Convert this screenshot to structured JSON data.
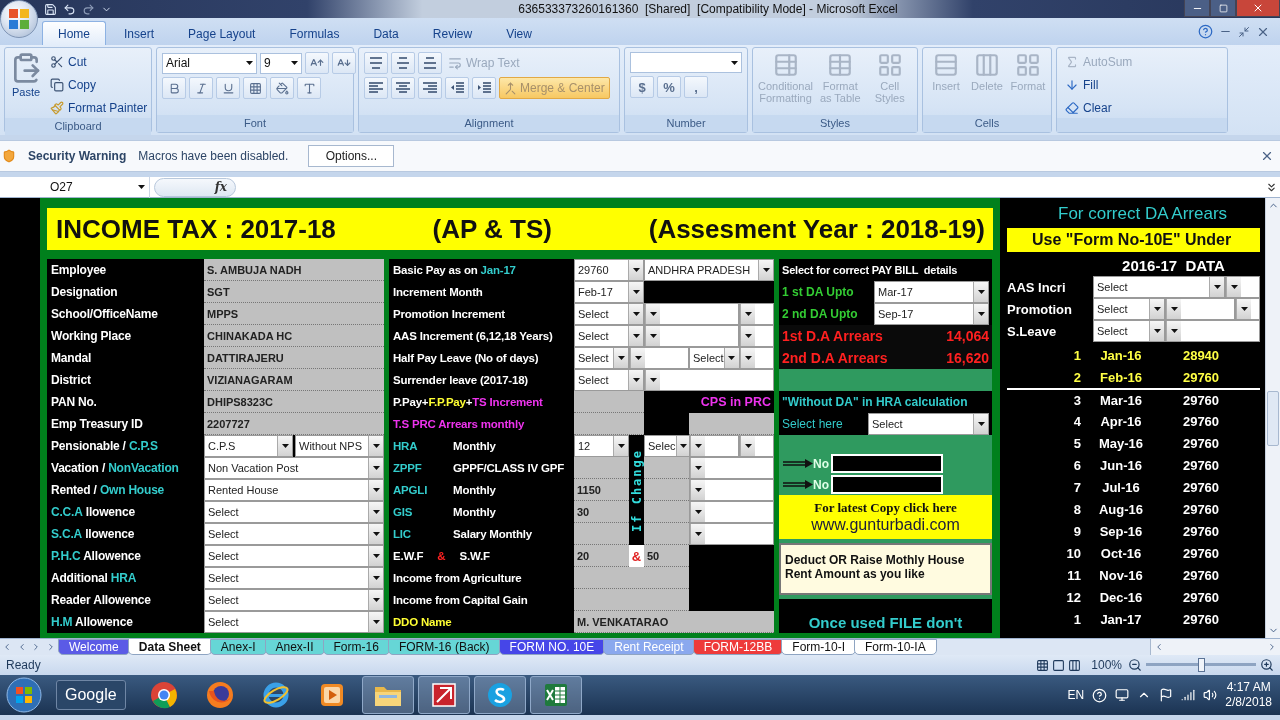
{
  "window": {
    "title": "636533373260161360  [Shared]  [Compatibility Mode] - Microsoft Excel"
  },
  "ribbon_tabs": [
    {
      "label": "Home",
      "selected": true
    },
    {
      "label": "Insert",
      "selected": false
    },
    {
      "label": "Page Layout",
      "selected": false
    },
    {
      "label": "Formulas",
      "selected": false
    },
    {
      "label": "Data",
      "selected": false
    },
    {
      "label": "Review",
      "selected": false
    },
    {
      "label": "View",
      "selected": false
    }
  ],
  "clipboard": {
    "label": "Clipboard",
    "paste": "Paste",
    "cut": "Cut",
    "copy": "Copy",
    "format_painter": "Format Painter"
  },
  "font": {
    "label": "Font",
    "name": "Arial",
    "size": "9"
  },
  "alignment": {
    "label": "Alignment",
    "wrap_text": "Wrap Text",
    "merge_center": "Merge & Center"
  },
  "number": {
    "label": "Number",
    "buttons": [
      "$",
      "%",
      ","
    ]
  },
  "styles": {
    "label": "Styles",
    "buttons": [
      {
        "label": "Conditional Formatting",
        "disabled": true
      },
      {
        "label": "Format as Table",
        "disabled": true
      },
      {
        "label": "Cell Styles",
        "disabled": true
      }
    ]
  },
  "cells": {
    "label": "Cells",
    "buttons": [
      {
        "label": "Insert",
        "disabled": true
      },
      {
        "label": "Delete",
        "disabled": true
      },
      {
        "label": "Format",
        "disabled": true
      }
    ]
  },
  "editing": {
    "buttons": [
      {
        "label": "AutoSum",
        "disabled": true
      },
      {
        "label": "Fill",
        "disabled": false
      },
      {
        "label": "Clear",
        "disabled": false
      }
    ]
  },
  "security_bar": {
    "title": "Security Warning",
    "message": "Macros have been disabled.",
    "button": "Options..."
  },
  "formula_bar": {
    "name_box": "O27",
    "function_label": "fx"
  },
  "banner": {
    "title": "INCOME TAX : 2017-18",
    "region": "(AP & TS)",
    "year": "(Assesment Year : 2018-19)"
  },
  "employee_rows": [
    {
      "label": [
        {
          "text": "Employee",
          "color": "#ffffff"
        }
      ],
      "fields": [
        {
          "kind": "text",
          "value": "S. AMBUJA NADH"
        }
      ]
    },
    {
      "label": [
        {
          "text": "Designation",
          "color": "#ffffff"
        }
      ],
      "fields": [
        {
          "kind": "text",
          "value": "SGT"
        }
      ]
    },
    {
      "label": [
        {
          "text": "School/OfficeName",
          "color": "#ffffff"
        }
      ],
      "fields": [
        {
          "kind": "text",
          "value": "MPPS"
        }
      ]
    },
    {
      "label": [
        {
          "text": "Working Place",
          "color": "#ffffff"
        }
      ],
      "fields": [
        {
          "kind": "text",
          "value": "CHINAKADA HC"
        }
      ]
    },
    {
      "label": [
        {
          "text": "Mandal",
          "color": "#ffffff"
        }
      ],
      "fields": [
        {
          "kind": "text",
          "value": "DATTIRAJERU"
        }
      ]
    },
    {
      "label": [
        {
          "text": "District",
          "color": "#ffffff"
        }
      ],
      "fields": [
        {
          "kind": "text",
          "value": "VIZIANAGARAM"
        }
      ]
    },
    {
      "label": [
        {
          "text": "PAN No.",
          "color": "#ffffff"
        }
      ],
      "fields": [
        {
          "kind": "text",
          "value": "DHIPS8323C"
        }
      ]
    },
    {
      "label": [
        {
          "text": "Emp Treasury ID",
          "color": "#ffffff"
        }
      ],
      "fields": [
        {
          "kind": "text",
          "value": "2207727"
        }
      ]
    },
    {
      "label": [
        {
          "text": "Pensionable / ",
          "color": "#ffffff"
        },
        {
          "text": "C.P.S",
          "color": "#33cccc"
        }
      ],
      "fields": [
        {
          "kind": "select",
          "value": "C.P.S"
        },
        {
          "kind": "select",
          "value": "Without NPS"
        }
      ]
    },
    {
      "label": [
        {
          "text": "Vacation / ",
          "color": "#ffffff"
        },
        {
          "text": "NonVacation",
          "color": "#33cccc"
        }
      ],
      "fields": [
        {
          "kind": "select",
          "value": "Non Vacation Post"
        }
      ]
    },
    {
      "label": [
        {
          "text": "Rented / ",
          "color": "#ffffff"
        },
        {
          "text": "Own House",
          "color": "#33cccc"
        }
      ],
      "fields": [
        {
          "kind": "select",
          "value": "Rented House"
        }
      ]
    },
    {
      "label": [
        {
          "text": "C.C.A",
          "color": "#33cccc"
        },
        {
          "text": " llowence",
          "color": "#ffffff"
        }
      ],
      "fields": [
        {
          "kind": "select",
          "value": "Select"
        }
      ]
    },
    {
      "label": [
        {
          "text": "S.C.A",
          "color": "#33cccc"
        },
        {
          "text": " llowence",
          "color": "#ffffff"
        }
      ],
      "fields": [
        {
          "kind": "select",
          "value": "Select"
        }
      ]
    },
    {
      "label": [
        {
          "text": "P.H.C",
          "color": "#33cccc"
        },
        {
          "text": " Allowence",
          "color": "#ffffff"
        }
      ],
      "fields": [
        {
          "kind": "select",
          "value": "Select"
        }
      ]
    },
    {
      "label": [
        {
          "text": "Additional ",
          "color": "#ffffff"
        },
        {
          "text": "HRA",
          "color": "#33cccc"
        }
      ],
      "fields": [
        {
          "kind": "select",
          "value": "Select"
        }
      ]
    },
    {
      "label": [
        {
          "text": "Reader Allowence",
          "color": "#ffffff"
        }
      ],
      "fields": [
        {
          "kind": "select",
          "value": "Select"
        }
      ]
    },
    {
      "label": [
        {
          "text": "H.M",
          "color": "#33cccc"
        },
        {
          "text": " Allowence",
          "color": "#ffffff"
        }
      ],
      "fields": [
        {
          "kind": "select",
          "value": "Select"
        }
      ]
    }
  ],
  "pay_rows": [
    {
      "kind": "two",
      "label": [
        {
          "text": "Basic Pay as on ",
          "color": "#ffffff"
        },
        {
          "text": "Jan-17",
          "color": "#33cccc"
        }
      ],
      "fields": [
        {
          "kind": "select",
          "value": "29760"
        },
        {
          "kind": "select",
          "value": "ANDHRA PRADESH"
        }
      ]
    },
    {
      "kind": "two",
      "label": [
        {
          "text": "Increment Month",
          "color": "#ffffff"
        }
      ],
      "fields": [
        {
          "kind": "select",
          "value": "Feb-17"
        },
        {
          "kind": "black"
        }
      ]
    },
    {
      "kind": "triple",
      "label": [
        {
          "text": "Promotion Increment",
          "color": "#ffffff"
        }
      ],
      "fields": [
        {
          "kind": "select",
          "value": "Select"
        },
        {
          "kind": "select"
        },
        {
          "kind": "select"
        }
      ]
    },
    {
      "kind": "triple",
      "label": [
        {
          "text": "AAS Increment (6,12,18 Years)",
          "color": "#ffffff"
        }
      ],
      "fields": [
        {
          "kind": "select",
          "value": "Select"
        },
        {
          "kind": "select"
        },
        {
          "kind": "select"
        }
      ]
    },
    {
      "kind": "quad",
      "label": [
        {
          "text": "Half Pay Leave (No of days)",
          "color": "#ffffff"
        }
      ],
      "fields": [
        {
          "kind": "select",
          "value": "Select"
        },
        {
          "kind": "select"
        },
        {
          "kind": "select",
          "value": "Select"
        },
        {
          "kind": "select"
        }
      ]
    },
    {
      "kind": "two",
      "label": [
        {
          "text": "Surrender leave (2017-18)",
          "color": "#ffffff"
        }
      ],
      "fields": [
        {
          "kind": "select",
          "value": "Select"
        },
        {
          "kind": "select"
        }
      ]
    },
    {
      "kind": "two",
      "label": [
        {
          "text": "P.Pay+",
          "color": "#ffffff"
        },
        {
          "text": "F.P.Pay",
          "color": "#ffff33"
        },
        {
          "text": "+",
          "color": "#ffffff"
        },
        {
          "text": "TS Increment",
          "color": "#ee33ee"
        }
      ],
      "fields": [
        {
          "kind": "text"
        },
        {
          "kind": "note",
          "value": "CPS in PRC"
        }
      ]
    },
    {
      "kind": "band",
      "label": [
        {
          "text": "T.S PRC Arrears monthly",
          "color": "#ee33ee"
        }
      ],
      "fields": [
        {
          "kind": "text"
        },
        {
          "kind": "black"
        },
        {
          "kind": "text"
        }
      ]
    },
    {
      "kind": "hra",
      "label": [
        {
          "text": "HRA",
          "color": "#33cccc"
        },
        {
          "text": "Monthly",
          "color": "#ffffff"
        }
      ],
      "fields": [
        {
          "kind": "select",
          "value": "12"
        },
        {
          "kind": "vertical",
          "value": "If Change"
        },
        {
          "kind": "select",
          "value": "Selec"
        },
        {
          "kind": "select"
        },
        {
          "kind": "select"
        }
      ]
    },
    {
      "kind": "ded",
      "label": [
        {
          "text": "ZPPF",
          "color": "#33cccc"
        },
        {
          "text": "GPPF/CLASS IV GPF",
          "color": "#ffffff"
        }
      ],
      "fields": [
        {
          "kind": "text"
        },
        {
          "kind": "text"
        },
        {
          "kind": "select"
        }
      ]
    },
    {
      "kind": "ded",
      "label": [
        {
          "text": "APGLI",
          "color": "#33cccc"
        },
        {
          "text": "Monthly",
          "color": "#ffffff"
        }
      ],
      "fields": [
        {
          "kind": "text",
          "value": "1150"
        },
        {
          "kind": "text"
        },
        {
          "kind": "select"
        }
      ]
    },
    {
      "kind": "ded",
      "label": [
        {
          "text": "GIS",
          "color": "#33cccc"
        },
        {
          "text": "Monthly",
          "color": "#ffffff"
        }
      ],
      "fields": [
        {
          "kind": "text",
          "value": "30"
        },
        {
          "kind": "text"
        },
        {
          "kind": "select"
        }
      ]
    },
    {
      "kind": "ded",
      "label": [
        {
          "text": "LIC",
          "color": "#33cccc"
        },
        {
          "text": "Salary Monthly",
          "color": "#ffffff"
        }
      ],
      "fields": [
        {
          "kind": "text"
        },
        {
          "kind": "text"
        },
        {
          "kind": "select"
        }
      ]
    },
    {
      "kind": "amp",
      "label": [
        {
          "text": "E.W.F",
          "color": "#ffffff"
        },
        {
          "text": "&",
          "color": "#ff2222"
        },
        {
          "text": "S.W.F",
          "color": "#ffffff"
        }
      ],
      "fields": [
        {
          "kind": "text",
          "value": "20"
        },
        {
          "kind": "amp",
          "value": "&"
        },
        {
          "kind": "text",
          "value": "50"
        },
        {
          "kind": "black"
        }
      ]
    },
    {
      "kind": "plain",
      "label": [
        {
          "text": "Income from Agriculture",
          "color": "#ffffff"
        }
      ],
      "fields": [
        {
          "kind": "text"
        },
        {
          "kind": "black"
        }
      ]
    },
    {
      "kind": "plain",
      "label": [
        {
          "text": "Income from Capital Gain",
          "color": "#ffffff"
        }
      ],
      "fields": [
        {
          "kind": "text"
        },
        {
          "kind": "black"
        }
      ]
    },
    {
      "kind": "full",
      "label": [
        {
          "text": "DDO Name",
          "color": "#ffff33"
        }
      ],
      "fields": [
        {
          "kind": "text",
          "value": "M. VENKATARAO"
        }
      ]
    }
  ],
  "pay_bill": {
    "header": "Select for correct PAY BILL  details",
    "da_rows": [
      {
        "label": "1 st DA Upto",
        "value": "Mar-17"
      },
      {
        "label": "2 nd DA Upto",
        "value": "Sep-17"
      }
    ],
    "arrears": [
      {
        "label": "1st D.A Arrears",
        "amount": "14,064"
      },
      {
        "label": "2nd D.A Arrears",
        "amount": "16,620"
      }
    ],
    "hra_header": "\"Without DA\" in HRA calculation",
    "hra_select": {
      "label": "Select here",
      "value": "Select"
    },
    "no_rows": [
      "No",
      "No"
    ],
    "latest": {
      "text": "For latest Copy click here",
      "link": "www.gunturbadi.com"
    },
    "note": "Deduct OR Raise Mothly House Rent Amount as you like",
    "warning": "Once used FILE don't"
  },
  "da_panel": {
    "title": "For correct DA Arrears",
    "notice": "Use \"Form No-10E\" Under",
    "heading": "2016-17  DATA",
    "selectors": [
      {
        "kind": "wide_first",
        "label": "AAS Incri",
        "fields": [
          {
            "kind": "select",
            "value": "Select"
          },
          {
            "kind": "select"
          }
        ]
      },
      {
        "kind": "three",
        "label": "Promotion",
        "fields": [
          {
            "kind": "select",
            "value": "Select"
          },
          {
            "kind": "select"
          },
          {
            "kind": "select"
          }
        ]
      },
      {
        "kind": "wide_last",
        "label": "S.Leave",
        "fields": [
          {
            "kind": "select",
            "value": "Select"
          },
          {
            "kind": "select"
          }
        ]
      }
    ],
    "months": [
      {
        "no": "1",
        "month": "Jan-16",
        "amount": "28940",
        "highlighted": true
      },
      {
        "no": "2",
        "month": "Feb-16",
        "amount": "29760",
        "highlighted": true
      },
      {
        "no": "3",
        "month": "Mar-16",
        "amount": "29760",
        "highlighted": false
      },
      {
        "no": "4",
        "month": "Apr-16",
        "amount": "29760",
        "highlighted": false
      },
      {
        "no": "5",
        "month": "May-16",
        "amount": "29760",
        "highlighted": false
      },
      {
        "no": "6",
        "month": "Jun-16",
        "amount": "29760",
        "highlighted": false
      },
      {
        "no": "7",
        "month": "Jul-16",
        "amount": "29760",
        "highlighted": false
      },
      {
        "no": "8",
        "month": "Aug-16",
        "amount": "29760",
        "highlighted": false
      },
      {
        "no": "9",
        "month": "Sep-16",
        "amount": "29760",
        "highlighted": false
      },
      {
        "no": "10",
        "month": "Oct-16",
        "amount": "29760",
        "highlighted": false
      },
      {
        "no": "11",
        "month": "Nov-16",
        "amount": "29760",
        "highlighted": false
      },
      {
        "no": "12",
        "month": "Dec-16",
        "amount": "29760",
        "highlighted": false
      },
      {
        "no": "1",
        "month": "Jan-17",
        "amount": "29760",
        "highlighted": false
      }
    ]
  },
  "sheet_tabs": [
    {
      "label": "Welcome",
      "color": "#5b5be6",
      "selected": false
    },
    {
      "label": "Data Sheet",
      "color": "#ffffff",
      "selected": true
    },
    {
      "label": "Anex-I",
      "color": "#66d6d6",
      "selected": false
    },
    {
      "label": "Anex-II",
      "color": "#66d6d6",
      "selected": false
    },
    {
      "label": "Form-16",
      "color": "#66d6d6",
      "selected": false
    },
    {
      "label": "FORM-16 (Back)",
      "color": "#66d6d6",
      "selected": false
    },
    {
      "label": "FORM NO. 10E",
      "color": "#4646e8",
      "selected": false
    },
    {
      "label": "Rent Receipt",
      "color": "#8aa8ee",
      "selected": false
    },
    {
      "label": "FORM-12BB",
      "color": "#ee3b3b",
      "selected": false
    },
    {
      "label": "Form-10-I",
      "color": "#ffffff",
      "selected": false
    },
    {
      "label": "Form-10-IA",
      "color": "#ffffff",
      "selected": false
    }
  ],
  "status_bar": {
    "status": "Ready",
    "zoom": "100%",
    "zoom_slider": {
      "level": 0.5
    }
  },
  "taskbar": {
    "search_label": "Google",
    "apps": [
      {
        "kind": "chrome",
        "active": false
      },
      {
        "kind": "firefox",
        "active": false
      },
      {
        "kind": "ie",
        "active": false
      },
      {
        "kind": "media",
        "active": false
      },
      {
        "kind": "explorer",
        "active": true
      },
      {
        "kind": "reader",
        "active": true
      },
      {
        "kind": "skype",
        "active": true
      },
      {
        "kind": "excel",
        "active": true
      }
    ],
    "language": "EN",
    "time": "4:17 AM",
    "date": "2/8/2018"
  }
}
